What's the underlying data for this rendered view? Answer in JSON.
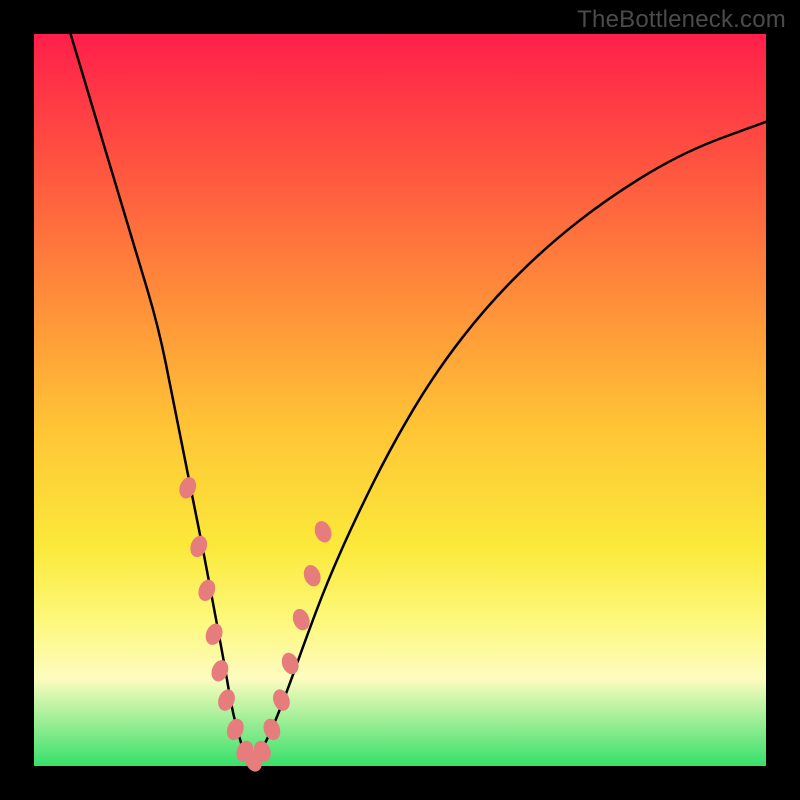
{
  "watermark": "TheBottleneck.com",
  "colors": {
    "gradient_top": "#ff1f4a",
    "gradient_mid1": "#ff8d3a",
    "gradient_mid2": "#fbe93a",
    "gradient_bottom": "#36e06a",
    "curve": "#000000",
    "bead": "#e77c7c",
    "frame": "#000000"
  },
  "chart_data": {
    "type": "line",
    "title": "",
    "xlabel": "",
    "ylabel": "",
    "xlim": [
      0,
      100
    ],
    "ylim": [
      0,
      100
    ],
    "note": "x and y are percent of plot area (0,0 = bottom-left). Two branches form a V meeting near the bottom; left branch is steep, right branch is shallower.",
    "series": [
      {
        "name": "left-branch",
        "x": [
          5,
          8,
          11,
          14,
          17,
          19,
          21,
          23,
          24.5,
          26,
          27,
          28,
          29,
          30
        ],
        "y": [
          100,
          90,
          80,
          70,
          60,
          50,
          40,
          30,
          22,
          14,
          8,
          4,
          1,
          0
        ]
      },
      {
        "name": "right-branch",
        "x": [
          30,
          31,
          32.5,
          34.5,
          37,
          40,
          44,
          49,
          55,
          62,
          70,
          79,
          89,
          100
        ],
        "y": [
          0,
          2,
          5,
          10,
          17,
          25,
          34,
          44,
          54,
          63,
          71,
          78,
          84,
          88
        ]
      }
    ],
    "beads": {
      "note": "pink rounded markers scattered near valley region on both branches",
      "points": [
        {
          "x": 21.0,
          "y": 38
        },
        {
          "x": 22.5,
          "y": 30
        },
        {
          "x": 23.6,
          "y": 24
        },
        {
          "x": 24.6,
          "y": 18
        },
        {
          "x": 25.4,
          "y": 13
        },
        {
          "x": 26.3,
          "y": 9
        },
        {
          "x": 27.5,
          "y": 5
        },
        {
          "x": 28.8,
          "y": 2
        },
        {
          "x": 30.0,
          "y": 0.7
        },
        {
          "x": 31.2,
          "y": 2
        },
        {
          "x": 32.5,
          "y": 5
        },
        {
          "x": 33.8,
          "y": 9
        },
        {
          "x": 35.0,
          "y": 14
        },
        {
          "x": 36.5,
          "y": 20
        },
        {
          "x": 38.0,
          "y": 26
        },
        {
          "x": 39.5,
          "y": 32
        }
      ]
    }
  }
}
